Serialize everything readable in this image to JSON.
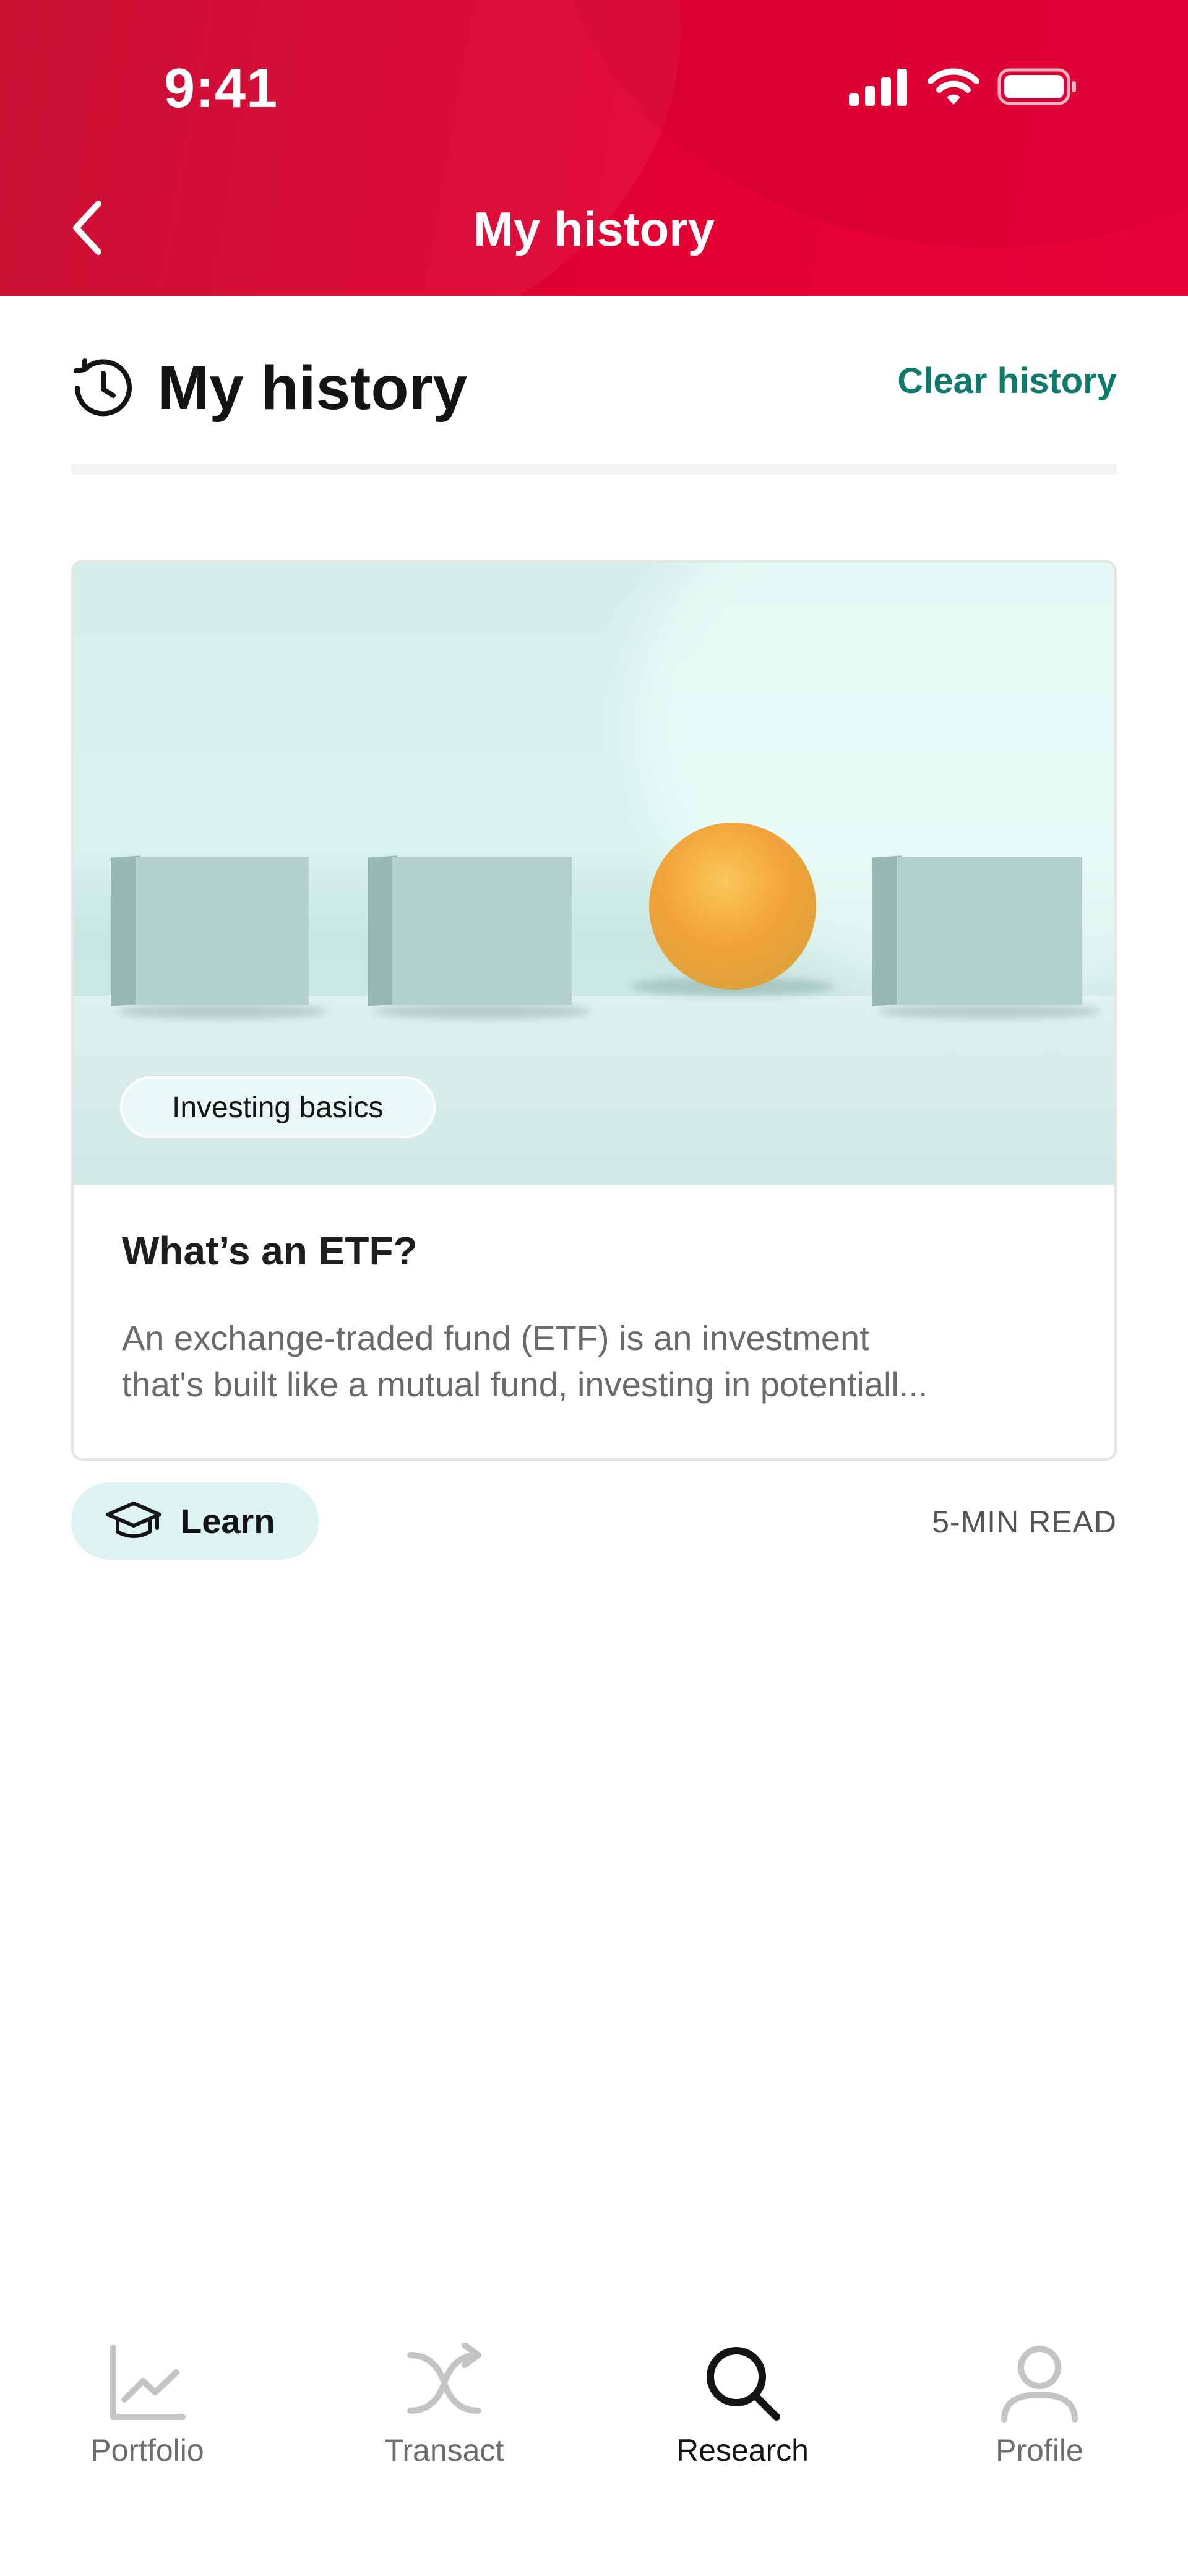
{
  "status_bar": {
    "time": "9:41",
    "icons": [
      "signal-icon",
      "wifi-icon",
      "battery-icon"
    ]
  },
  "header": {
    "title": "My history",
    "back_icon": "chevron-left-icon"
  },
  "section": {
    "title": "My history",
    "icon": "history-clock-icon",
    "clear_label": "Clear history"
  },
  "card": {
    "tag": "Investing basics",
    "title": "What’s an ETF?",
    "description_line1": "An exchange-traded fund (ETF) is an investment",
    "description_line2": "that's built like a mutual fund, investing in potentiall..."
  },
  "meta": {
    "category_label": "Learn",
    "category_icon": "graduation-cap-icon",
    "read_time": "5-MIN READ"
  },
  "bottom_nav": {
    "items": [
      {
        "label": "Portfolio",
        "icon": "chart-line-icon",
        "active": false
      },
      {
        "label": "Transact",
        "icon": "shuffle-icon",
        "active": false
      },
      {
        "label": "Research",
        "icon": "search-icon",
        "active": true
      },
      {
        "label": "Profile",
        "icon": "person-icon",
        "active": false
      }
    ]
  },
  "colors": {
    "brand_red": "#e40033",
    "accent_teal": "#0e7a6b",
    "chip_bg": "#dcf3f1"
  }
}
